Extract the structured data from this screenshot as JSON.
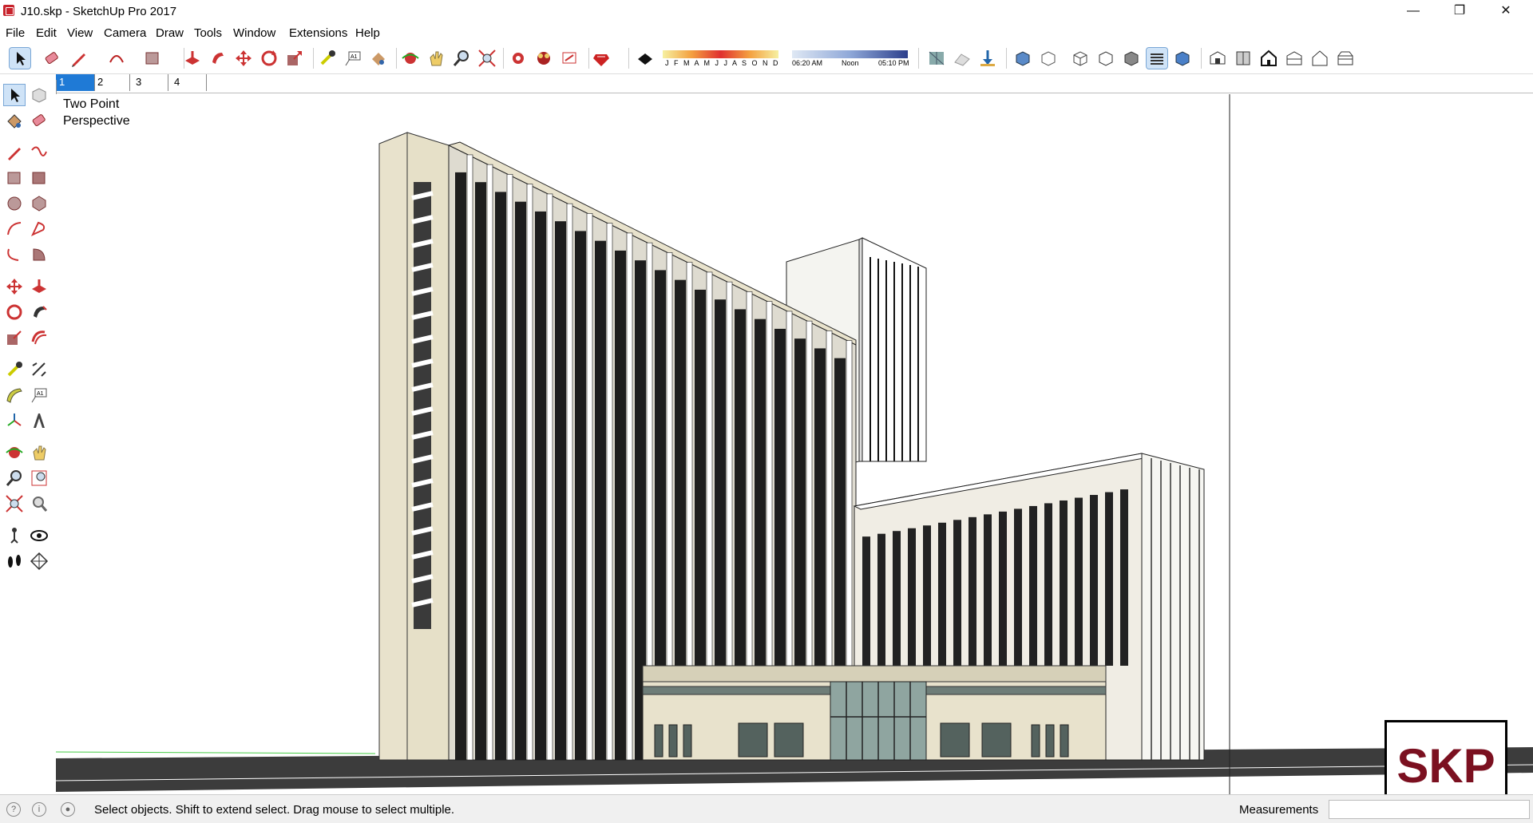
{
  "window": {
    "title": "J10.skp - SketchUp Pro 2017",
    "minimize": "—",
    "restore": "❐",
    "close": "✕"
  },
  "menu": [
    "File",
    "Edit",
    "View",
    "Camera",
    "Draw",
    "Tools",
    "Window",
    "Extensions",
    "Help"
  ],
  "shadow": {
    "months": "J F M A M J J A S O N D",
    "time_start": "06:20 AM",
    "time_noon": "Noon",
    "time_end": "05:10 PM"
  },
  "scene_tabs": [
    "1",
    "2",
    "3",
    "4"
  ],
  "active_tab": "1",
  "viewport": {
    "label_line1": "Two Point",
    "label_line2": "Perspective"
  },
  "status": {
    "hint": "Select objects. Shift to extend select. Drag mouse to select multiple.",
    "measurements_label": "Measurements"
  },
  "watermark": "SKP",
  "colors": {
    "accent": "#1f7ad6",
    "brand": "#7b1020",
    "building_wall": "#e8e2cc",
    "glass": "#1a1a1a"
  }
}
